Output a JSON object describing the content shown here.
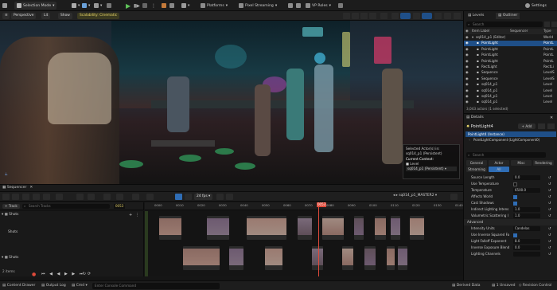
{
  "toolbar": {
    "mode": "Selection Mode",
    "platforms": "Platforms",
    "pixel_streaming": "Pixel Streaming",
    "vp_roles": "VP Roles",
    "settings": "Settings"
  },
  "viewport": {
    "perspective": "Perspective",
    "lit": "Lit",
    "show": "Show",
    "scalability": "Scalability: Cinematic",
    "selection": {
      "title": "Selected Actor(s) in:",
      "level": "sq014_p1 (Persistent)",
      "context_label": "Current Context:",
      "context_type": "Level",
      "context_level": "sq014_p1 (Persistent)"
    }
  },
  "outliner": {
    "tab_levels": "Levels",
    "tab_outliner": "Outliner",
    "search_placeholder": "Search",
    "col_label": "Item Label",
    "col_sequencer": "Sequencer",
    "col_type": "Type",
    "rows": [
      {
        "label": "sq014_p1 (Editor)",
        "type": "World"
      },
      {
        "label": "PointLight",
        "type": "PointL"
      },
      {
        "label": "PointLight",
        "type": "PointL"
      },
      {
        "label": "PointLight",
        "type": "PointL"
      },
      {
        "label": "PointLight",
        "type": "PointL"
      },
      {
        "label": "RectLight",
        "type": "RectLi"
      },
      {
        "label": "Sequence",
        "type": "LevelS"
      },
      {
        "label": "Sequence",
        "type": "LevelS"
      },
      {
        "label": "sq014_p1",
        "type": "Level"
      },
      {
        "label": "sq014_p1",
        "type": "Level"
      },
      {
        "label": "sq014_p1",
        "type": "Level"
      },
      {
        "label": "sq014_p1",
        "type": "Level"
      }
    ],
    "count": "3,043 actors (1 selected)"
  },
  "details": {
    "title": "Details",
    "actor_name": "PointLight4",
    "add": "+ Add",
    "instance": "PointLight4 (Instance)",
    "component": "PointLightComponent (LightComponent0)",
    "search_placeholder": "Search",
    "tabs": [
      "General",
      "Actor",
      "Misc",
      "Rendering",
      "Streaming",
      "All"
    ],
    "props": [
      {
        "label": "Source Length",
        "value": "0.0",
        "kind": "num"
      },
      {
        "label": "Use Temperature",
        "kind": "check",
        "on": false
      },
      {
        "label": "Temperature",
        "value": "6500.0",
        "kind": "num"
      },
      {
        "label": "Affects World",
        "kind": "check",
        "on": true
      },
      {
        "label": "Cast Shadows",
        "kind": "check",
        "on": true
      },
      {
        "label": "Indirect Lighting Intens",
        "value": "1.0",
        "kind": "num"
      },
      {
        "label": "Volumetric Scattering I",
        "value": "1.0",
        "kind": "num"
      }
    ],
    "advanced": "Advanced",
    "props2": [
      {
        "label": "Intensity Units",
        "value": "Candelas",
        "kind": "num"
      },
      {
        "label": "Use Inverse Squared Fa",
        "kind": "check",
        "on": true
      },
      {
        "label": "Light Falloff Exponent",
        "value": "8.0",
        "kind": "num"
      },
      {
        "label": "Inverse Exposure Blend",
        "value": "0.0",
        "kind": "num"
      },
      {
        "label": "Lighting Channels",
        "value": "",
        "kind": "num"
      }
    ]
  },
  "sequencer": {
    "title": "Sequencer",
    "track_btn": "+ Track",
    "search_placeholder": "Search Tracks",
    "frame": "0053",
    "fps": "24 fps",
    "sequence": "sq014_p1_MASTER2",
    "tracks": [
      {
        "name": "Shots"
      },
      {
        "name": "Shots"
      },
      {
        "name": "Shots"
      }
    ],
    "items": "2 items",
    "ticks": [
      "0000",
      "0010",
      "0020",
      "0030",
      "0040",
      "0050",
      "0060",
      "0070",
      "0080",
      "0090",
      "0100",
      "0110",
      "0120",
      "0130",
      "0140"
    ],
    "playhead": "0053"
  },
  "status": {
    "content_drawer": "Content Drawer",
    "output_log": "Output Log",
    "cmd": "Cmd",
    "console_placeholder": "Enter Console Command",
    "derived_data": "Derived Data",
    "unsaved": "1 Unsaved",
    "revision": "Revision Control"
  },
  "colors": {
    "accent": "#2f6db5",
    "selected_row": "#1f4f88",
    "playhead": "#e04a3a"
  }
}
